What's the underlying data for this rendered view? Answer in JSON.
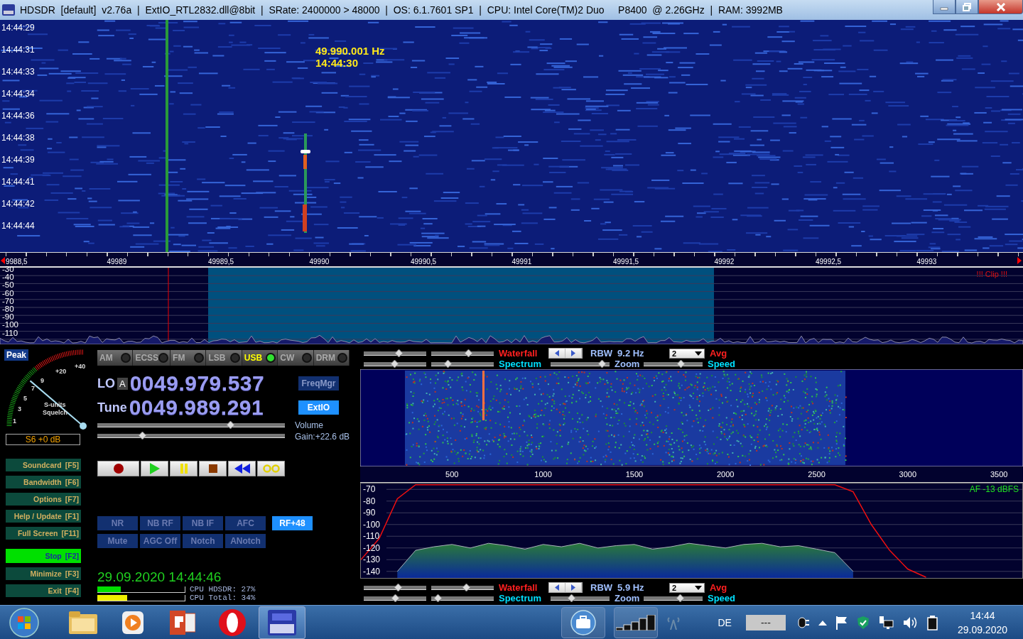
{
  "window": {
    "title": "HDSDR  [default]  v2.76a  |  ExtIO_RTL2832.dll@8bit  |  SRate: 2400000 > 48000  |  OS: 6.1.7601 SP1  |  CPU: Intel Core(TM)2 Duo     P8400  @ 2.26GHz  |  RAM: 3992MB"
  },
  "waterfall": {
    "timestamps": [
      "14:44:29",
      "14:44:31",
      "14:44:33",
      "14:44:34",
      "14:44:36",
      "14:44:38",
      "14:44:39",
      "14:44:41",
      "14:44:42",
      "14:44:44"
    ],
    "marker_frequency": "49.990.001 Hz",
    "marker_time": "14:44:30"
  },
  "rf_spectrum": {
    "frequency_ticks": [
      "9988,5",
      "49989",
      "49989,5",
      "49990",
      "49990,5",
      "49991",
      "49991,5",
      "49992",
      "49992,5",
      "49993"
    ],
    "db_labels": [
      "-30",
      "-40",
      "-50",
      "-60",
      "-70",
      "-80",
      "-90",
      "-100",
      "-110"
    ],
    "clip_warning": "!!! Clip !!!"
  },
  "smeter": {
    "peak_label": "Peak",
    "scale": [
      "+40",
      "+20",
      "9",
      "7",
      "5",
      "3",
      "1"
    ],
    "caption_1": "S-units",
    "caption_2": "Squelch",
    "reading": "S6 +0 dB"
  },
  "modes": [
    {
      "label": "AM",
      "selected": false
    },
    {
      "label": "ECSS",
      "selected": false
    },
    {
      "label": "FM",
      "selected": false
    },
    {
      "label": "LSB",
      "selected": false
    },
    {
      "label": "USB",
      "selected": true
    },
    {
      "label": "CW",
      "selected": false
    },
    {
      "label": "DRM",
      "selected": false
    }
  ],
  "lo": {
    "label": "LO",
    "vfo": "A",
    "frequency": "0049.979.537"
  },
  "tune": {
    "label": "Tune",
    "frequency": "0049.989.291"
  },
  "freqmgr": {
    "label": "FreqMgr",
    "selected": false
  },
  "extio": {
    "label": "ExtIO",
    "selected": true
  },
  "volume": {
    "label": "Volume",
    "level": 0.72
  },
  "gain": {
    "label": "Gain:+22.6 dB",
    "level": 0.23
  },
  "transport": [
    {
      "kind": "record"
    },
    {
      "kind": "play"
    },
    {
      "kind": "pause"
    },
    {
      "kind": "stop"
    },
    {
      "kind": "rewind"
    },
    {
      "kind": "loop"
    }
  ],
  "side_buttons": [
    {
      "label": "Soundcard",
      "key": "[F5]",
      "selected": false
    },
    {
      "label": "Bandwidth",
      "key": "[F6]",
      "selected": false
    },
    {
      "label": "Options",
      "key": "[F7]",
      "selected": false
    },
    {
      "label": "Help / Update",
      "key": "[F1]",
      "selected": false
    },
    {
      "label": "Full Screen",
      "key": "[F11]",
      "selected": false
    },
    {
      "label": "Stop",
      "key": "[F2]",
      "selected": true
    },
    {
      "label": "Minimize",
      "key": "[F3]",
      "selected": false
    },
    {
      "label": "Exit",
      "key": "[F4]",
      "selected": false
    }
  ],
  "dsp_rows": [
    {
      "buttons": [
        {
          "label": "NR",
          "on": false
        },
        {
          "label": "NB RF",
          "on": false
        },
        {
          "label": "NB IF",
          "on": false
        },
        {
          "label": "AFC",
          "on": false
        },
        {
          "label": "RF+48",
          "on": true
        }
      ]
    },
    {
      "buttons": [
        {
          "label": "Mute",
          "on": false
        },
        {
          "label": "AGC Off",
          "on": false
        },
        {
          "label": "Notch",
          "on": false
        },
        {
          "label": "ANotch",
          "on": false
        }
      ]
    }
  ],
  "clock": "29.09.2020 14:44:46",
  "cpu": [
    {
      "label": "CPU HDSDR: 27%",
      "level": 0.27,
      "color": "#00e000"
    },
    {
      "label": "CPU Total: 34%",
      "level": 0.34,
      "color": "#f0f000"
    }
  ],
  "top_controls": {
    "sliders": [
      {
        "level": 0.57
      },
      {
        "level": 0.61
      },
      {
        "level": 0.49
      },
      {
        "level": 0.24
      }
    ],
    "waterfall_label": "Waterfall",
    "spectrum_label": "Spectrum",
    "rbw_label": "RBW",
    "rbw_value": "9.2 Hz",
    "avg_value": "2",
    "avg_label": "Avg",
    "zoom_label": "Zoom",
    "zoom": {
      "level": 0.93
    },
    "speed_label": "Speed",
    "speed": {
      "level": 0.65
    }
  },
  "audio_spectrum": {
    "af_level": "AF -13 dBFS",
    "chart_data": {
      "type": "line",
      "x": [
        0,
        100,
        200,
        300,
        400,
        500,
        600,
        700,
        800,
        900,
        1000,
        1100,
        1200,
        1300,
        1400,
        1500,
        1600,
        1700,
        1800,
        1900,
        2000,
        2100,
        2200,
        2300,
        2400,
        2500,
        2600,
        2700,
        2800,
        2900,
        3000,
        3100
      ],
      "series": [
        {
          "color": "#f01010",
          "values": [
            -130,
            -112,
            -78,
            -66,
            -66,
            -66,
            -66,
            -66,
            -66,
            -66,
            -66,
            -66,
            -66,
            -66,
            -66,
            -66,
            -66,
            -66,
            -66,
            -66,
            -66,
            -66,
            -66,
            -66,
            -66,
            -66,
            -66,
            -72,
            -100,
            -122,
            -138,
            -145
          ]
        },
        {
          "color": "#a8b0b8",
          "values": [
            null,
            null,
            -140,
            -122,
            -119,
            -117,
            -120,
            -116,
            -118,
            -121,
            -117,
            -119,
            -116,
            -120,
            -118,
            -117,
            -121,
            -119,
            -116,
            -118,
            -120,
            -117,
            -116,
            -119,
            -118,
            -121,
            -124,
            -140,
            null,
            null,
            null,
            null
          ]
        }
      ],
      "grid": true,
      "xlim": [
        0,
        3628
      ],
      "ylim": [
        -145.6,
        -65
      ],
      "xticks": [
        500,
        1000,
        1500,
        2000,
        2500,
        3000,
        3500
      ],
      "yticks": [
        -70,
        -80,
        -90,
        -100,
        -110,
        -120,
        -130,
        -140
      ]
    }
  },
  "bottom_controls": {
    "sliders": [
      {
        "level": 0.56
      },
      {
        "level": 0.57
      },
      {
        "level": 0.51
      },
      {
        "level": 0.05
      }
    ],
    "waterfall_label": "Waterfall",
    "spectrum_label": "Spectrum",
    "rbw_label": "RBW",
    "rbw_value": "5.9 Hz",
    "avg_value": "2",
    "avg_label": "Avg",
    "zoom_label": "Zoom",
    "zoom": {
      "level": 0.34
    },
    "speed_label": "Speed",
    "speed": {
      "level": 0.64
    }
  },
  "taskbar": {
    "apps": [
      {
        "kind": "folder",
        "selected": false
      },
      {
        "kind": "media",
        "selected": false
      },
      {
        "kind": "slides",
        "selected": false
      },
      {
        "kind": "browser",
        "selected": false
      },
      {
        "kind": "radio",
        "selected": true
      }
    ],
    "language": "DE",
    "battery_reading": "---",
    "time": "14:44",
    "date": "29.09.2020"
  }
}
